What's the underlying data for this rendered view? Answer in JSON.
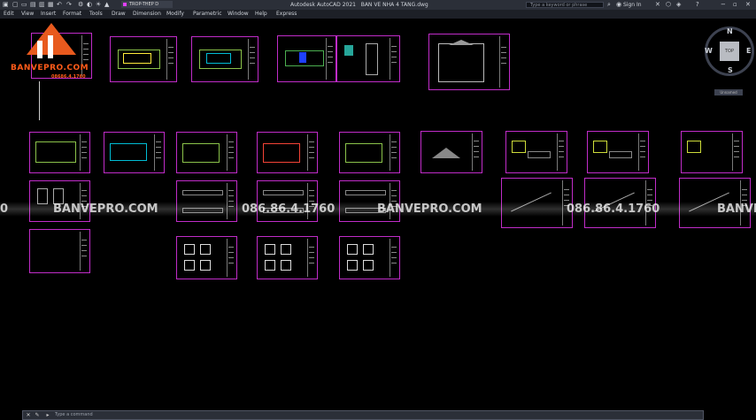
{
  "titlebar": {
    "app": "Autodesk AutoCAD 2021",
    "file": "BAN VE NHA 4 TANG.dwg"
  },
  "search": {
    "placeholder": "Type a keyword or phrase"
  },
  "user": {
    "signin": "Sign In"
  },
  "layer": {
    "name": "TROP-THEP D"
  },
  "menu": [
    "Edit",
    "View",
    "Insert",
    "Format",
    "Tools",
    "Draw",
    "Dimension",
    "Modify",
    "Parametric",
    "Window",
    "Help",
    "Express"
  ],
  "logo": {
    "brand": "BANVEPRO.COM",
    "phone": "08686.4.1760"
  },
  "watermark": [
    "0",
    "BANVEPRO.COM",
    "086.86.4.1760",
    "BANVEPRO.COM",
    "086.86.4.1760",
    "BANVE"
  ],
  "viewcube": {
    "top": "TOP",
    "n": "N",
    "s": "S",
    "e": "E",
    "w": "W",
    "wcs": "Unnamed"
  },
  "command": {
    "placeholder": "Type a command"
  },
  "colors": {
    "accent": "#c02cc8",
    "bg": "#000000",
    "logo": "#ff5c1a"
  }
}
